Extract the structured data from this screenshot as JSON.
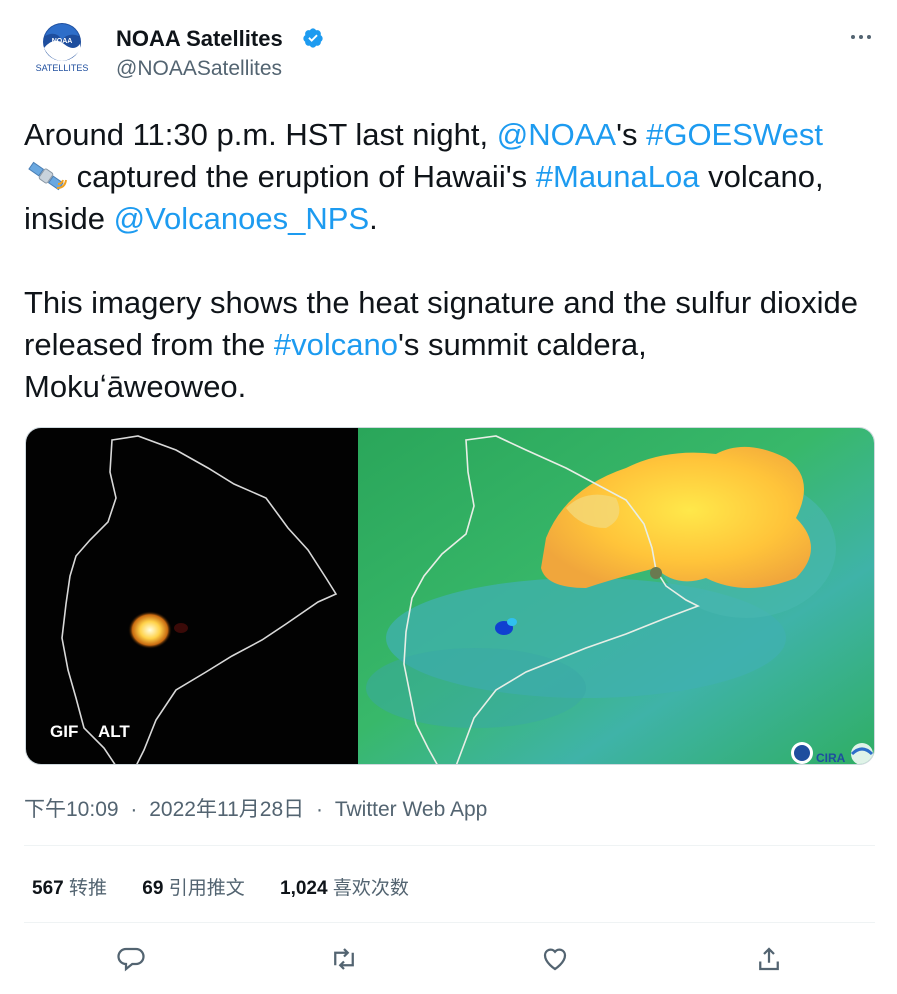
{
  "author": {
    "display_name": "NOAA Satellites",
    "handle": "@NOAASatellites",
    "logo_text": "NOAA",
    "logo_subtext": "SATELLITES",
    "verified": true
  },
  "tweet": {
    "p1": [
      {
        "t": "Around 11:30 p.m. HST last night, ",
        "link": false
      },
      {
        "t": "@NOAA",
        "link": true
      },
      {
        "t": "'s ",
        "link": false
      },
      {
        "t": "#GOESWest",
        "link": true
      },
      {
        "t": "emoji",
        "link": false
      },
      {
        "t": " captured the eruption of Hawaii's ",
        "link": false
      },
      {
        "t": "#MaunaLoa",
        "link": true
      },
      {
        "t": " volcano, inside ",
        "link": false
      },
      {
        "t": "@Volcanoes_NPS",
        "link": true
      },
      {
        "t": ".",
        "link": false
      }
    ],
    "p2": [
      {
        "t": "This imagery shows the heat signature and the sulfur dioxide released from the ",
        "link": false
      },
      {
        "t": "#volcano",
        "link": true
      },
      {
        "t": "'s summit caldera, Mokuʻāweoweo.",
        "link": false
      }
    ]
  },
  "media": {
    "gif_badge": "GIF",
    "alt_badge": "ALT"
  },
  "meta": {
    "time": "下午10:09",
    "separator1": "·",
    "date": "2022年11月28日",
    "separator2": "·",
    "source": "Twitter Web App"
  },
  "stats": {
    "retweets_count": "567",
    "retweets_label": "转推",
    "quotes_count": "69",
    "quotes_label": "引用推文",
    "likes_count": "1,024",
    "likes_label": "喜欢次数"
  },
  "colors": {
    "link": "#1d9bf0",
    "muted": "#536471",
    "text": "#0f1419",
    "verified": "#1d9bf0"
  },
  "icons": [
    "noaa-logo-icon",
    "verified-badge-icon",
    "more-icon",
    "satellite-emoji-icon",
    "reply-icon",
    "retweet-icon",
    "like-icon",
    "share-icon"
  ]
}
